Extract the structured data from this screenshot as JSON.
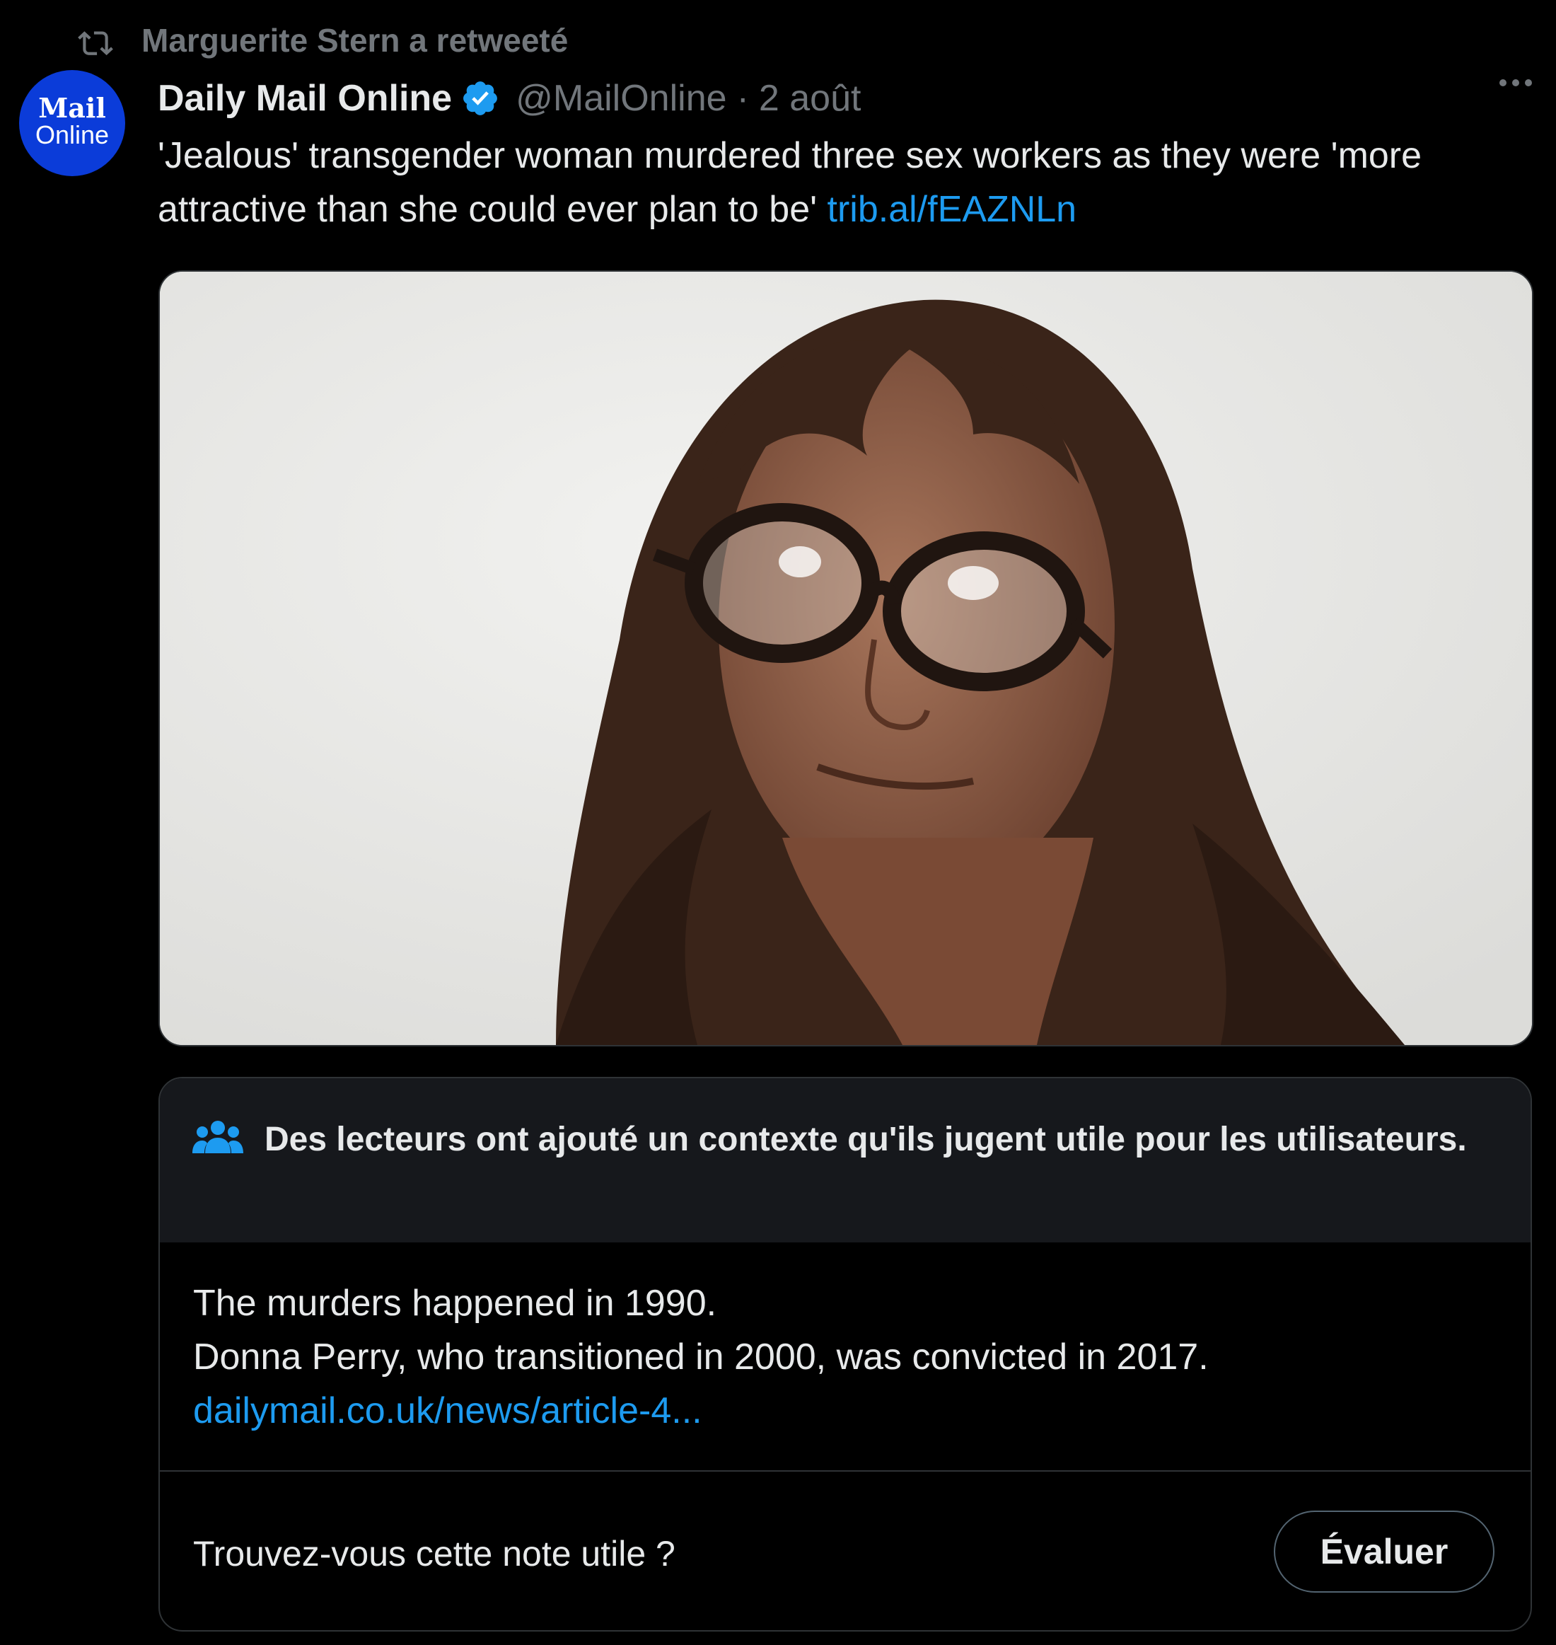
{
  "retweet": {
    "icon": "retweet-icon",
    "label": "Marguerite Stern a retweeté"
  },
  "author": {
    "avatar_top": "Mail",
    "avatar_bottom": "Online",
    "display_name": "Daily Mail Online",
    "verified_icon": "verified-badge-icon",
    "handle": "@MailOnline",
    "separator": "·",
    "date": "2 août"
  },
  "tweet": {
    "text": "'Jealous' transgender woman murdered three sex workers as they were 'more attractive than she could ever plan to be'",
    "link": "trib.al/fEAZNLn"
  },
  "media": {
    "type": "photo"
  },
  "community_note": {
    "icon": "people-icon",
    "title": "Des lecteurs ont ajouté un contexte qu'ils jugent utile pour les utilisateurs.",
    "lines": [
      "The murders happened in 1990.",
      "Donna Perry, who transitioned in 2000, was convicted in 2017."
    ],
    "link": "dailymail.co.uk/news/article-4...",
    "question": "Trouvez-vous cette note utile ?",
    "rate_button": "Évaluer"
  },
  "colors": {
    "background": "#000000",
    "text_primary": "#e7e9ea",
    "text_secondary": "#71767b",
    "link": "#1d9bf0",
    "verified": "#1d9bf0",
    "avatar_bg": "#0b3cd9",
    "border": "#2f3336",
    "note_header_bg": "#16181c"
  }
}
